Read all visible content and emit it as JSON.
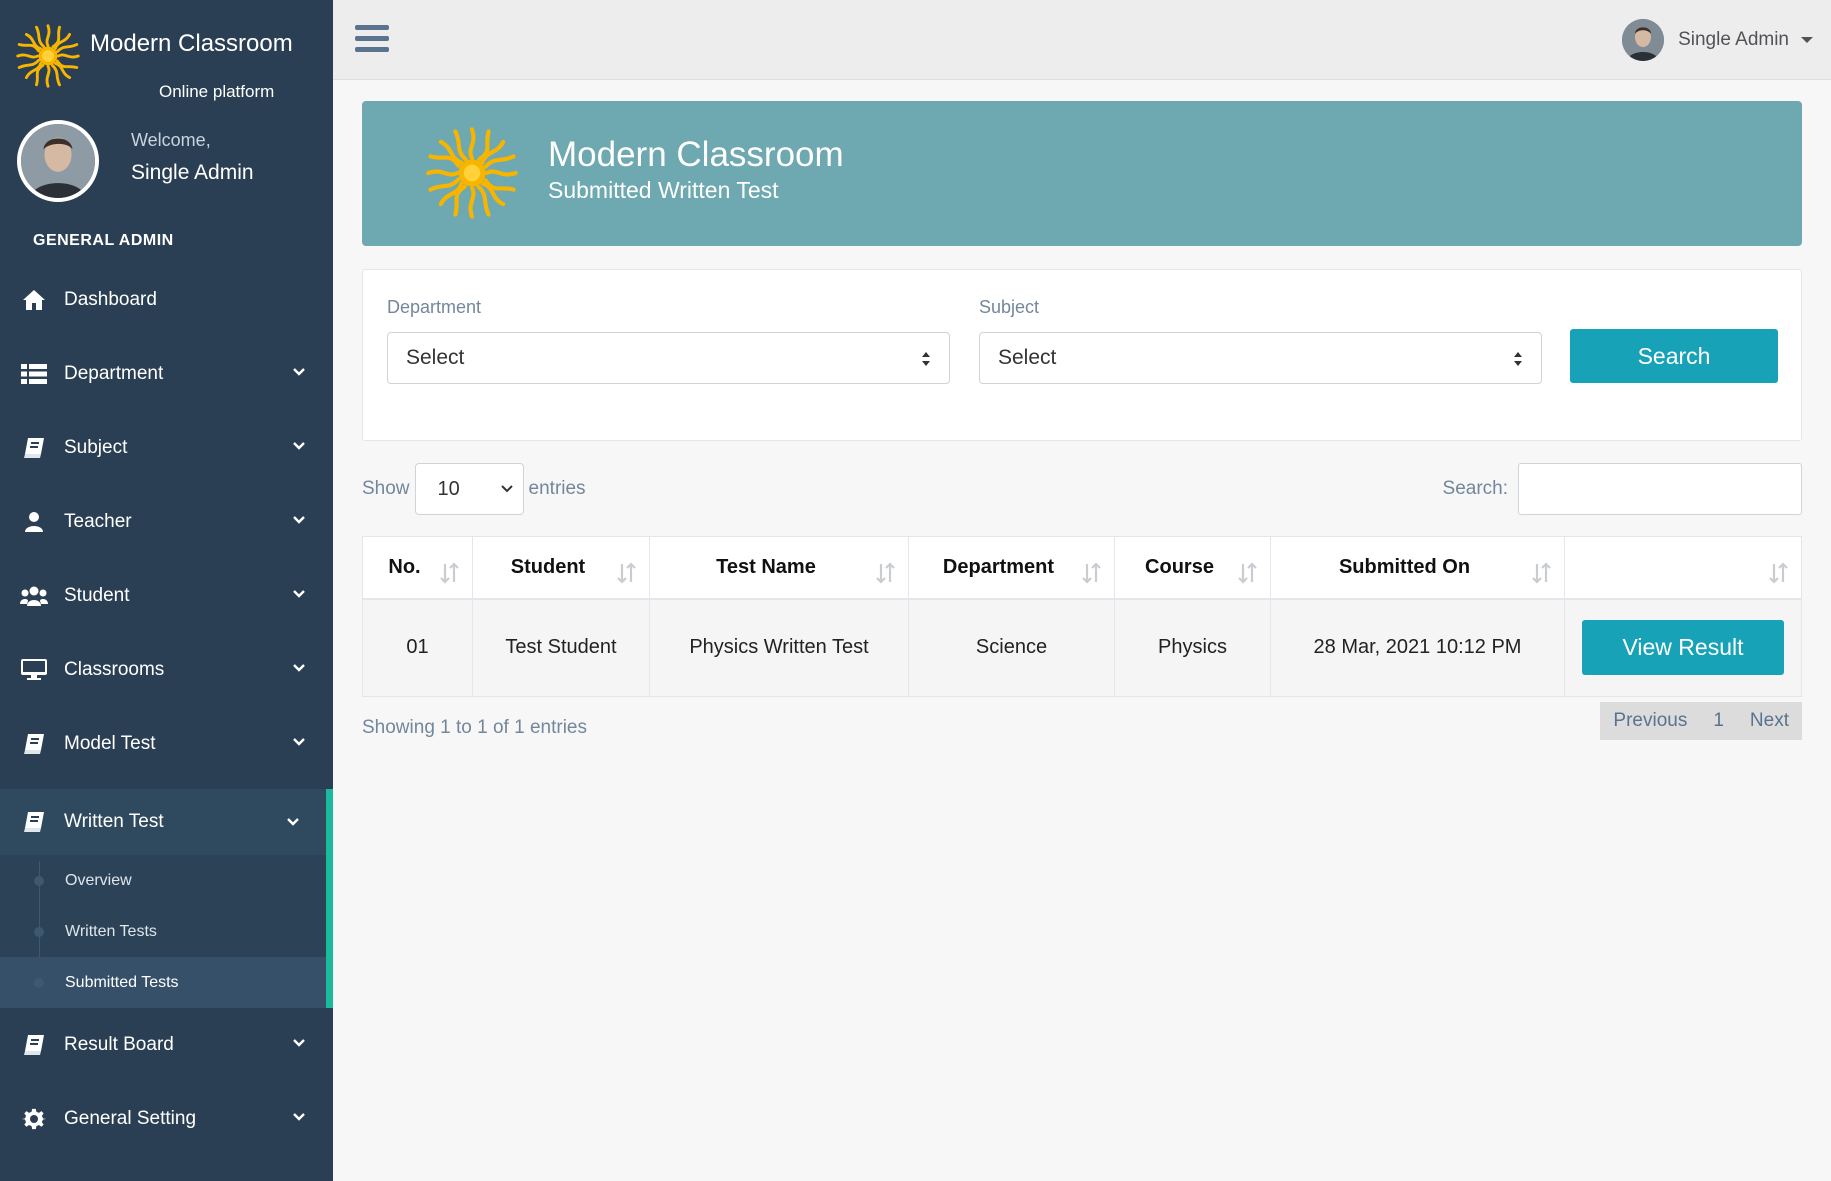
{
  "brand": {
    "title": "Modern Classroom",
    "subtitle": "Online platform"
  },
  "profile": {
    "welcome": "Welcome,",
    "name": "Single Admin"
  },
  "sidebar": {
    "section_title": "GENERAL ADMIN",
    "items": [
      {
        "label": "Dashboard",
        "icon": "home-icon"
      },
      {
        "label": "Department",
        "icon": "list-icon"
      },
      {
        "label": "Subject",
        "icon": "book-icon"
      },
      {
        "label": "Teacher",
        "icon": "user-icon"
      },
      {
        "label": "Student",
        "icon": "users-icon"
      },
      {
        "label": "Classrooms",
        "icon": "desktop-icon"
      },
      {
        "label": "Model Test",
        "icon": "book-icon"
      },
      {
        "label": "Written Test",
        "icon": "book-icon"
      },
      {
        "label": "Result Board",
        "icon": "book-icon"
      },
      {
        "label": "General Setting",
        "icon": "gear-icon"
      }
    ],
    "written_sub": [
      "Overview",
      "Written Tests",
      "Submitted Tests"
    ]
  },
  "topbar": {
    "user": "Single Admin"
  },
  "banner": {
    "title": "Modern Classroom",
    "subtitle": "Submitted Written Test"
  },
  "filter": {
    "department_label": "Department",
    "department_value": "Select",
    "subject_label": "Subject",
    "subject_value": "Select",
    "search_label": "Search"
  },
  "table_controls": {
    "show": "Show",
    "entries_value": "10",
    "entries": "entries",
    "search_label": "Search:"
  },
  "table": {
    "headers": [
      "No.",
      "Student",
      "Test Name",
      "Department",
      "Course",
      "Submitted On",
      ""
    ],
    "rows": [
      [
        "01",
        "Test Student",
        "Physics Written Test",
        "Science",
        "Physics",
        "28 Mar, 2021 10:12 PM"
      ]
    ],
    "action_label": "View Result"
  },
  "footer": {
    "info": "Showing 1 to 1 of 1 entries",
    "prev": "Previous",
    "page": "1",
    "next": "Next"
  },
  "colors": {
    "sidebar": "#2a3f54",
    "accent": "#1abb9c",
    "button": "#17a2b8",
    "banner": "#6ea8b1"
  }
}
